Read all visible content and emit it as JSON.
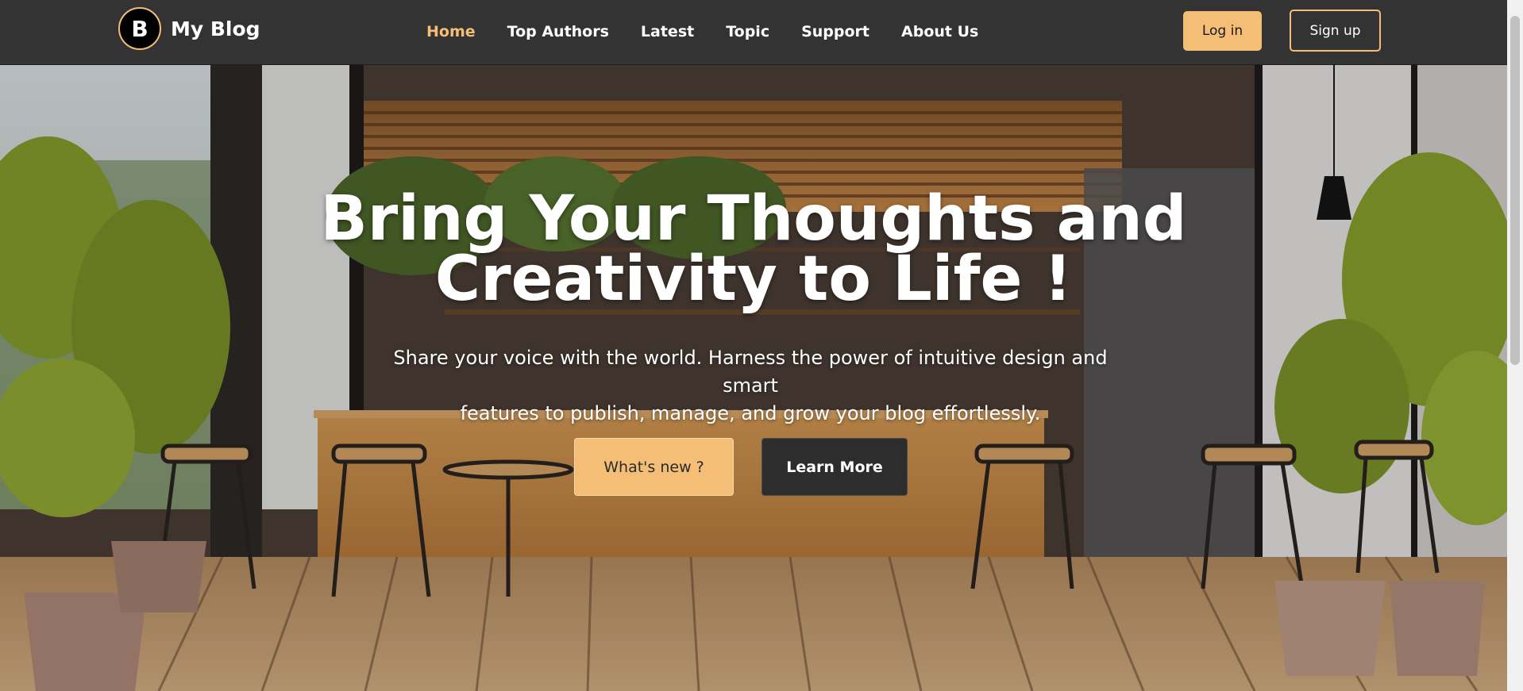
{
  "brand": {
    "logo_letter": "B",
    "name": "My Blog"
  },
  "nav": {
    "items": [
      {
        "label": "Home",
        "active": true
      },
      {
        "label": "Top Authors",
        "active": false
      },
      {
        "label": "Latest",
        "active": false
      },
      {
        "label": "Topic",
        "active": false
      },
      {
        "label": "Support",
        "active": false
      },
      {
        "label": "About Us",
        "active": false
      }
    ]
  },
  "auth": {
    "login_label": "Log in",
    "signup_label": "Sign up"
  },
  "hero": {
    "headline_line1": "Bring Your Thoughts and",
    "headline_line2": "Creativity to Life !",
    "subtitle_line1": "Share your voice with the world. Harness the power of intuitive design and smart",
    "subtitle_line2": "features to publish, manage, and grow your blog effortlessly.",
    "primary_button": "What's new ?",
    "secondary_button": "Learn More"
  },
  "colors": {
    "accent": "#f4be77",
    "navbar_bg": "#333333",
    "dark_button": "#2d2d2d"
  },
  "icons": {
    "logo": "letter-b-logo-icon"
  }
}
